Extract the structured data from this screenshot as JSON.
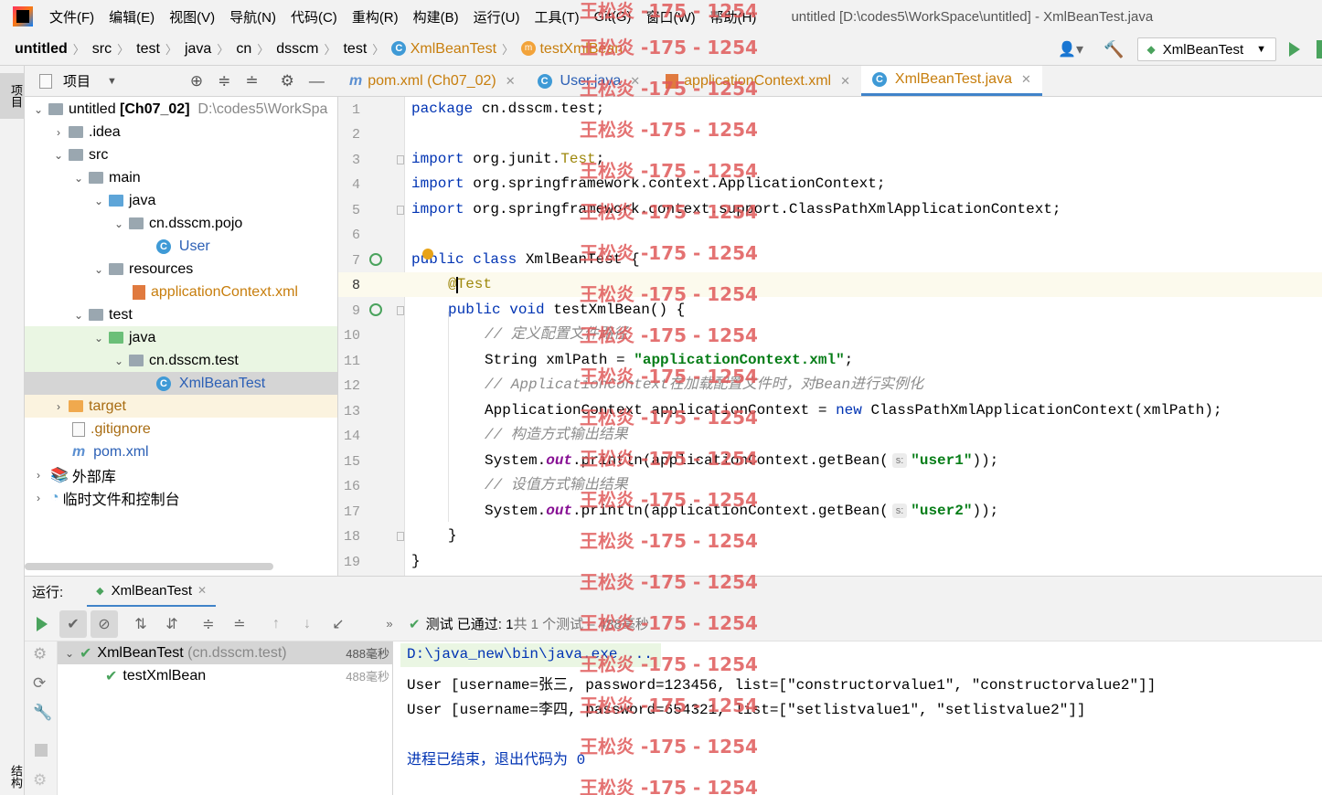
{
  "menu": {
    "items": [
      "文件(F)",
      "编辑(E)",
      "视图(V)",
      "导航(N)",
      "代码(C)",
      "重构(R)",
      "构建(B)",
      "运行(U)",
      "工具(T)",
      "Git(G)",
      "窗口(W)",
      "帮助(H)"
    ],
    "window_title": "untitled [D:\\codes5\\WorkSpace\\untitled] - XmlBeanTest.java"
  },
  "navbar": {
    "crumbs": [
      "untitled",
      "src",
      "test",
      "java",
      "cn",
      "dsscm",
      "test",
      "XmlBeanTest",
      "testXmlBean"
    ],
    "run_config": "XmlBeanTest"
  },
  "left_stripe": {
    "project_tab": "项目",
    "structure_tab": "结构"
  },
  "project_panel": {
    "title": "项目",
    "tree": [
      {
        "label": "untitled",
        "bold": "[Ch07_02]",
        "path": "D:\\codes5\\WorkSpa"
      },
      {
        "label": ".idea"
      },
      {
        "label": "src"
      },
      {
        "label": "main"
      },
      {
        "label": "java"
      },
      {
        "label": "cn.dsscm.pojo"
      },
      {
        "label": "User"
      },
      {
        "label": "resources"
      },
      {
        "label": "applicationContext.xml"
      },
      {
        "label": "test"
      },
      {
        "label": "java"
      },
      {
        "label": "cn.dsscm.test"
      },
      {
        "label": "XmlBeanTest"
      },
      {
        "label": "target"
      },
      {
        "label": ".gitignore"
      },
      {
        "label": "pom.xml"
      },
      {
        "label": "外部库"
      },
      {
        "label": "临时文件和控制台"
      }
    ]
  },
  "editor": {
    "tabs": [
      {
        "label": "pom.xml (Ch07_02)",
        "icon": "m"
      },
      {
        "label": "User.java",
        "icon": "C"
      },
      {
        "label": "applicationContext.xml",
        "icon": "xml"
      },
      {
        "label": "XmlBeanTest.java",
        "icon": "C"
      }
    ],
    "line_numbers": [
      "1",
      "2",
      "3",
      "4",
      "5",
      "6",
      "7",
      "8",
      "9",
      "10",
      "11",
      "12",
      "13",
      "14",
      "15",
      "16",
      "17",
      "18",
      "19"
    ],
    "code": {
      "l1_kw": "package",
      "l1_rest": " cn.dsscm.test;",
      "l3_kw": "import",
      "l3_a": " org.junit.",
      "l3_b": "Test",
      "l3_c": ";",
      "l4_kw": "import",
      "l4_rest": " org.springframework.context.ApplicationContext;",
      "l5_kw": "import",
      "l5_rest": " org.springframework.context.support.ClassPathXmlApplicationContext;",
      "l7_kw": "public class",
      "l7_rest": " XmlBeanTest {",
      "l8": "@Test",
      "l9_kw": "public void",
      "l9_rest": " testXmlBean() {",
      "l10": "// 定义配置文件路径",
      "l11_a": "String xmlPath = ",
      "l11_str": "\"applicationContext.xml\"",
      "l11_b": ";",
      "l12": "// ApplicationContext在加载配置文件时，对Bean进行实例化",
      "l13_a": "ApplicationContext applicationContext = ",
      "l13_kw": "new",
      "l13_b": " ClassPathXmlApplicationContext(xmlPath);",
      "l14": "// 构造方式输出结果",
      "l15_a": "System.",
      "l15_it": "out",
      "l15_b": ".println(applicationContext.getBean(",
      "l15_hint": "s:",
      "l15_str": "\"user1\"",
      "l15_c": "));",
      "l16": "// 设值方式输出结果",
      "l17_a": "System.",
      "l17_it": "out",
      "l17_b": ".println(applicationContext.getBean(",
      "l17_hint": "s:",
      "l17_str": "\"user2\"",
      "l17_c": "));",
      "l18": "}",
      "l19": "}"
    }
  },
  "run_panel": {
    "label": "运行:",
    "tab": "XmlBeanTest",
    "status_bold": "测试 已通过: 1",
    "status_rest": "共 1 个测试 – 488毫秒",
    "tests": [
      {
        "name": "XmlBeanTest",
        "pkg": "(cn.dsscm.test)",
        "duration": "488毫秒"
      },
      {
        "name": "testXmlBean",
        "duration": "488毫秒"
      }
    ],
    "console": [
      "D:\\java_new\\bin\\java.exe ...",
      "User [username=张三, password=123456, list=[\"constructorvalue1\", \"constructorvalue2\"]]",
      "User [username=李四, password=654321, list=[\"setlistvalue1\", \"setlistvalue2\"]]",
      "",
      "进程已结束，退出代码为 0"
    ]
  },
  "watermark": "王松炎 -175 - 1254"
}
